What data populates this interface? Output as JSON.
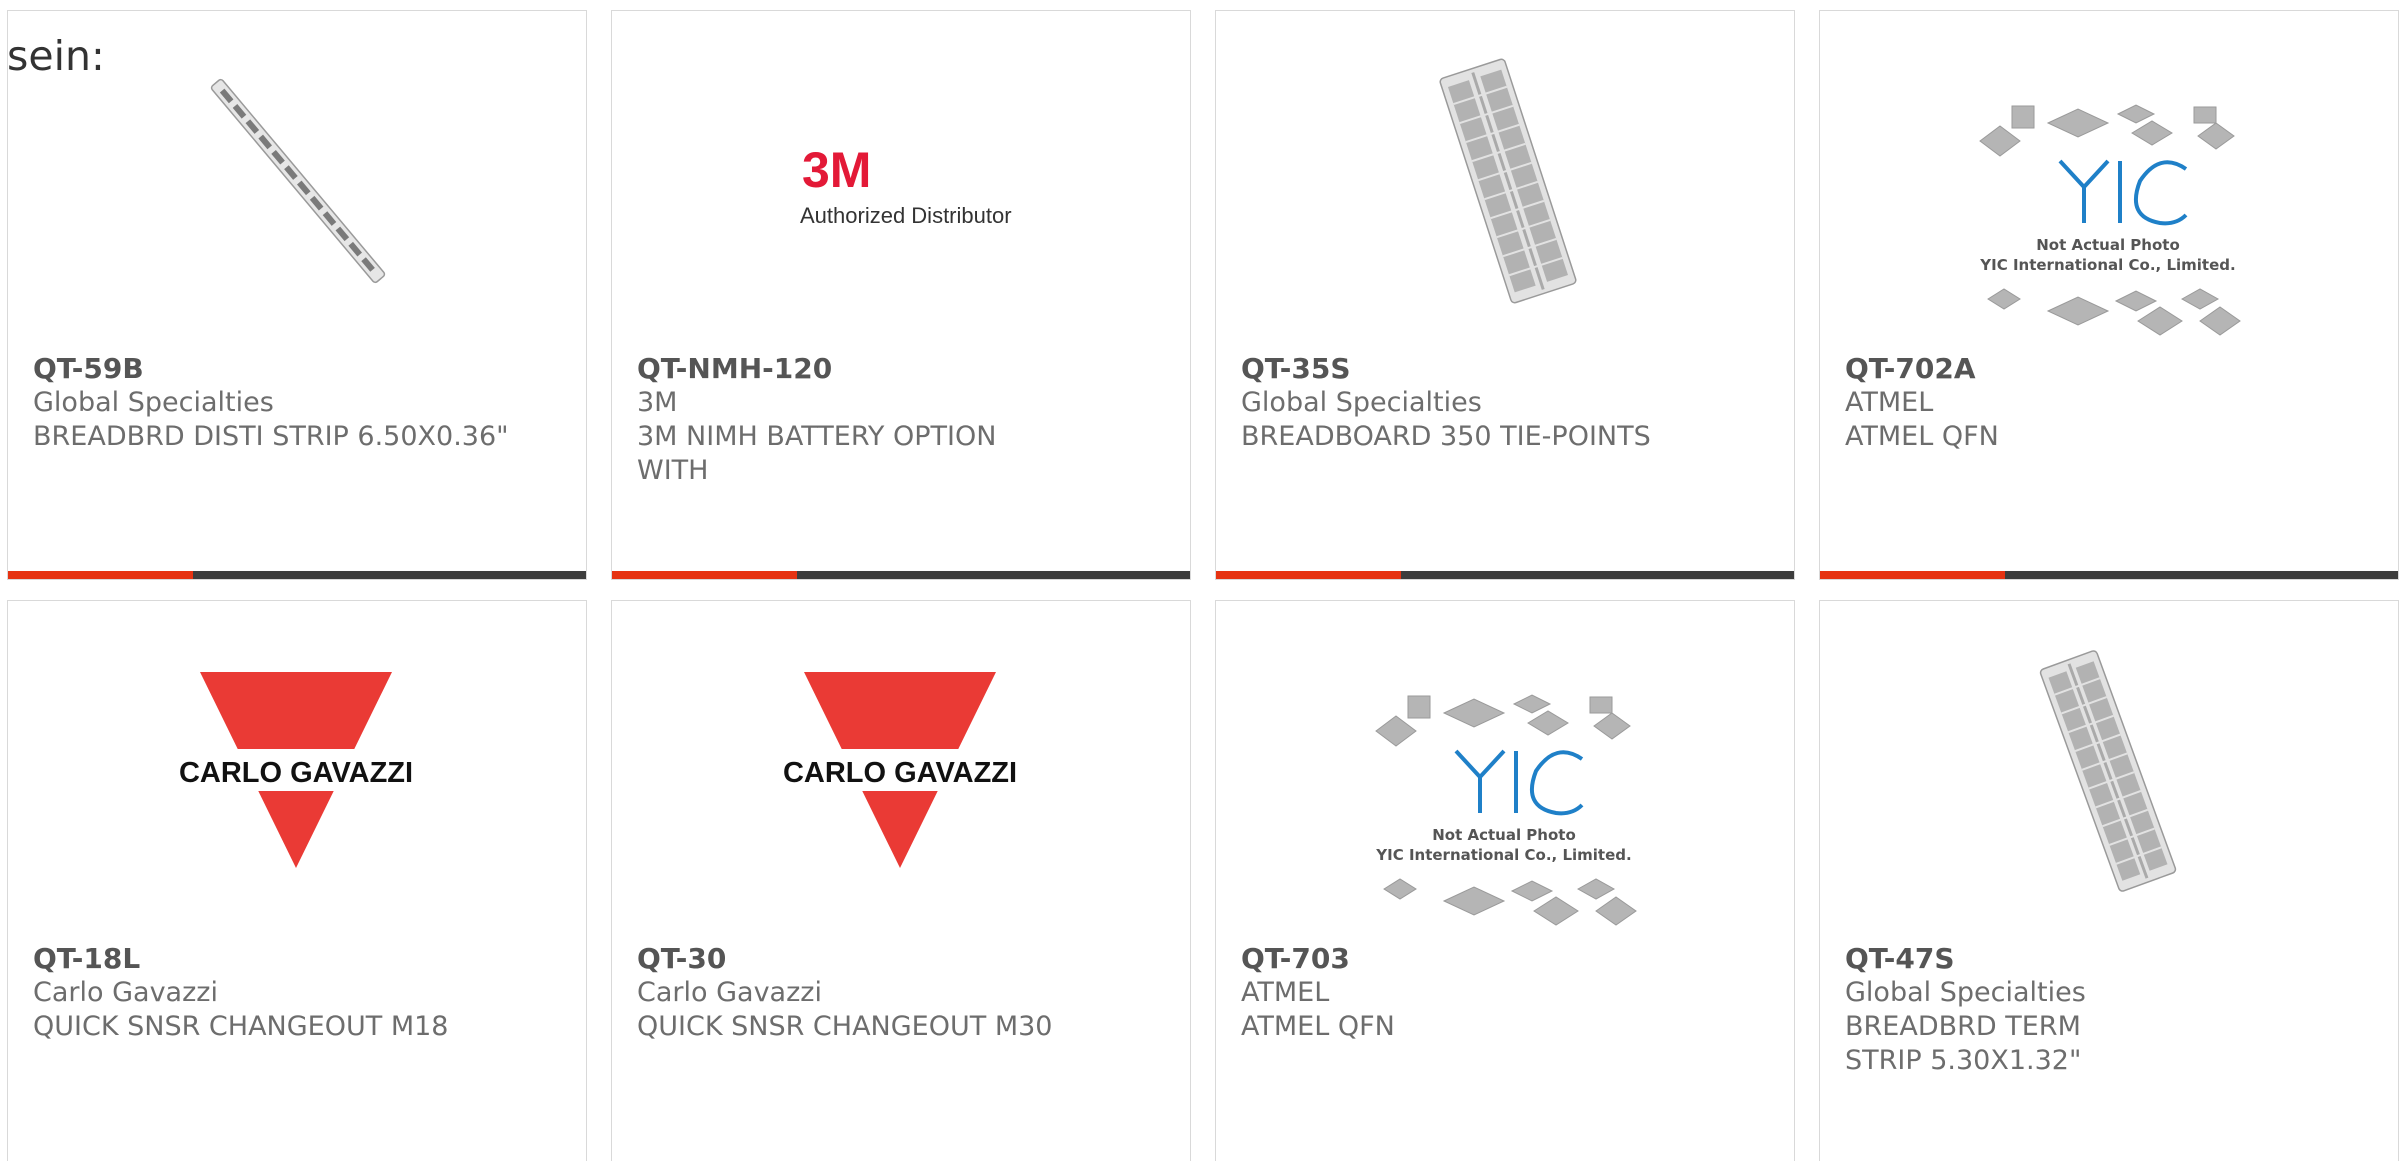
{
  "intro_text": "sein:",
  "colors": {
    "accent": "#e63312",
    "bar_track": "#3d3d3d",
    "card_border": "#d9d9d9",
    "part_text": "#555555",
    "body_text": "#6d6d6d",
    "3m_red": "#e31937",
    "carlo_gavazzi_red": "#ea3a35",
    "yic_blue": "#1f80c8"
  },
  "products": [
    {
      "part_number": "QT-59B",
      "manufacturer": "Global Specialties",
      "description": "BREADBRD DISTI STRIP 6.50X0.36\"",
      "image": "breadboard-strip-image",
      "progress": 0.32
    },
    {
      "part_number": "QT-NMH-120",
      "manufacturer": "3M",
      "description": "3M NIMH BATTERY OPTION WITH",
      "image": "3m-logo-image",
      "logo_text": "3M",
      "logo_subtext": "Authorized Distributor",
      "progress": 0.32
    },
    {
      "part_number": "QT-35S",
      "manufacturer": "Global Specialties",
      "description": "BREADBOARD 350 TIE-POINTS",
      "image": "breadboard-image",
      "progress": 0.32
    },
    {
      "part_number": "QT-702A",
      "manufacturer": "ATMEL",
      "description": "ATMEL QFN",
      "image": "yic-placeholder-image",
      "image_line1": "Not Actual Photo",
      "image_line2": "YIC International Co., Limited.",
      "progress": 0.32
    },
    {
      "part_number": "QT-18L",
      "manufacturer": "Carlo Gavazzi",
      "description": "QUICK SNSR CHANGEOUT M18",
      "image": "carlo-gavazzi-logo-image",
      "logo_text": "CARLO GAVAZZI"
    },
    {
      "part_number": "QT-30",
      "manufacturer": "Carlo Gavazzi",
      "description": "QUICK SNSR CHANGEOUT M30",
      "image": "carlo-gavazzi-logo-image",
      "logo_text": "CARLO GAVAZZI"
    },
    {
      "part_number": "QT-703",
      "manufacturer": "ATMEL",
      "description": "ATMEL QFN",
      "image": "yic-placeholder-image",
      "image_line1": "Not Actual Photo",
      "image_line2": "YIC International Co., Limited."
    },
    {
      "part_number": "QT-47S",
      "manufacturer": "Global Specialties",
      "description": "BREADBRD TERM STRIP 5.30X1.32\"",
      "image": "breadboard-image"
    }
  ]
}
